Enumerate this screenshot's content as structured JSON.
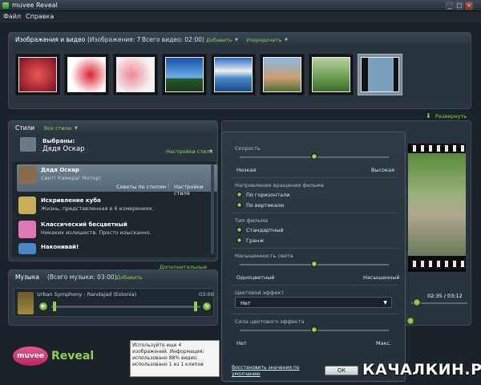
{
  "window": {
    "title": "muvee Reveal",
    "minimize": "_",
    "maximize": "□",
    "close": "×"
  },
  "menu": {
    "file": "Файл",
    "help": "Справка"
  },
  "images": {
    "header": "Изображения и видео",
    "count_text": "(Изображения: 7",
    "total_video": "Всего видео: 02:00)",
    "add": "Добавить",
    "sort": "Упорядочить",
    "expand": "Развернуть",
    "thumbs": [
      {
        "color": "#c43a4a"
      },
      {
        "color": "#e06a6a"
      },
      {
        "color": "#e9c9c9"
      },
      {
        "color": "#3f7fcf"
      },
      {
        "color": "#4a86c8"
      },
      {
        "color": "#6aa0d8"
      },
      {
        "color": "#7fb27a"
      },
      {
        "color": "#4d8a52"
      }
    ]
  },
  "styles": {
    "tab": "Стили",
    "all": "Все стили",
    "selected_label": "Выбраны:",
    "selected_name": "Дядя Оскар",
    "settings_link": "Настройки стиля",
    "tips": "Советы по стилям",
    "item_settings": "Настройки стиля",
    "more": "Дополнительные стили",
    "items": [
      {
        "name": "Дядя Оскар",
        "desc": "Свет! Камера! Мотор!",
        "color": "#8b6c4a"
      },
      {
        "name": "Искривление куба",
        "desc": "Жизнь, представленная в 6 измерениях.",
        "color": "#c9ac5a"
      },
      {
        "name": "Классический бесцветный",
        "desc": "Никаких излишеств. Просто изысканно.",
        "color": "#e076b6"
      },
      {
        "name": "Наконивай!",
        "desc": "",
        "color": "#4a86c8"
      }
    ]
  },
  "music": {
    "title": "Музыка",
    "total": "(Всего музыки: 03:00)",
    "add": "Добавить",
    "track_name": "Urban Symphony - Randajad (Estonia)",
    "track_time": "03:00"
  },
  "preview": {
    "time": "02:35 / 03:12"
  },
  "info": {
    "text": "Используйте еще 4 изображений. Информация: использовано 88% видео. использовано 1 из 1 клипов"
  },
  "logo": {
    "brand": "muvee",
    "product": "Reveal"
  },
  "settings": {
    "speed": {
      "label": "Скорость",
      "low": "Низкая",
      "high": "Высокая",
      "value": 0.5
    },
    "rotation": {
      "label": "Направление вращения фильма",
      "opt1": "По горизонтали",
      "opt2": "По вертикали"
    },
    "film_type": {
      "label": "Тип фильма",
      "opt1": "Стандартный",
      "opt2": "Гранж"
    },
    "saturation": {
      "label": "Насыщенность света",
      "low": "Одноцветный",
      "high": "Насыщенный",
      "value": 0.5
    },
    "color_effect": {
      "label": "Цветовой эффект",
      "value": "Нет"
    },
    "effect_strength": {
      "label": "Сила цветового эффекта",
      "low": "Нет",
      "high": "Макс.",
      "value": 0.5
    },
    "restore": "Восстановить значения по умолчанию",
    "ok": "ОК"
  },
  "watermark": "КАЧАЛКИН.РУ"
}
